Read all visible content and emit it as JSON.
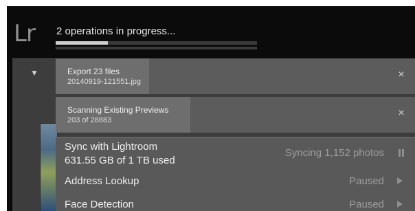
{
  "identity": {
    "logo": "Lr",
    "status": "2 operations in progress...",
    "progress_fraction": 0.26
  },
  "panel": {
    "collapse_glyph": "▼"
  },
  "operations": [
    {
      "title": "Export 23 files",
      "detail": "20140919-121551.jpg",
      "close": "×"
    },
    {
      "title": "Scanning Existing Previews",
      "detail": "203 of 28883",
      "close": "×"
    }
  ],
  "services": {
    "sync": {
      "name": "Sync with Lightroom",
      "detail": "631.55 GB of 1 TB used",
      "state": "Syncing 1,152 photos",
      "control_icon": "pause-icon"
    },
    "address": {
      "name": "Address Lookup",
      "state": "Paused",
      "control_icon": "play-icon"
    },
    "face": {
      "name": "Face Detection",
      "state": "Paused",
      "control_icon": "play-icon"
    }
  }
}
